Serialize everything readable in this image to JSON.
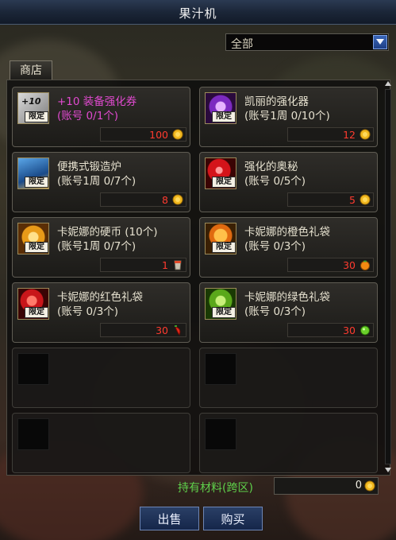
{
  "window": {
    "title": "果汁机"
  },
  "filter": {
    "selected": "全部"
  },
  "shop_tab": {
    "label": "商店"
  },
  "items": [
    {
      "name": "+10 装备强化券",
      "limit_text": "(账号 0/1个)",
      "price": "100",
      "currency": "gold-coin-icon",
      "badge": "限定",
      "icon": "+10-ticket"
    },
    {
      "name": "凯丽的强化器",
      "limit_text": "(账号1周 0/10个)",
      "price": "12",
      "currency": "gold-coin-icon",
      "badge": "限定",
      "icon": "purple-orb"
    },
    {
      "name": "便携式锻造炉",
      "limit_text": "(账号1周 0/7个)",
      "price": "8",
      "currency": "gold-coin-icon",
      "badge": "限定",
      "icon": "forge"
    },
    {
      "name": "强化的奥秘",
      "limit_text": "(账号 0/5个)",
      "price": "5",
      "currency": "gold-coin-icon",
      "badge": "限定",
      "icon": "red-orb"
    },
    {
      "name": "卡妮娜的硬币 (10个)",
      "limit_text": "(账号1周 0/7个)",
      "price": "1",
      "currency": "cup-icon",
      "badge": "限定",
      "icon": "coin"
    },
    {
      "name": "卡妮娜的橙色礼袋",
      "limit_text": "(账号 0/3个)",
      "price": "30",
      "currency": "orange-fruit-icon",
      "badge": "限定",
      "icon": "orange-bag"
    },
    {
      "name": "卡妮娜的红色礼袋",
      "limit_text": "(账号 0/3个)",
      "price": "30",
      "currency": "red-pepper-icon",
      "badge": "限定",
      "icon": "red-bag"
    },
    {
      "name": "卡妮娜的绿色礼袋",
      "limit_text": "(账号 0/3个)",
      "price": "30",
      "currency": "green-fruit-icon",
      "badge": "限定",
      "icon": "green-bag"
    }
  ],
  "owned": {
    "label": "持有材料(跨区)",
    "value": "0"
  },
  "buttons": {
    "sell": "出售",
    "buy": "购买"
  },
  "colors": {
    "price": "#ff3b2f",
    "owned_label": "#5fd04b",
    "highlight_name": "#e14ad0"
  }
}
